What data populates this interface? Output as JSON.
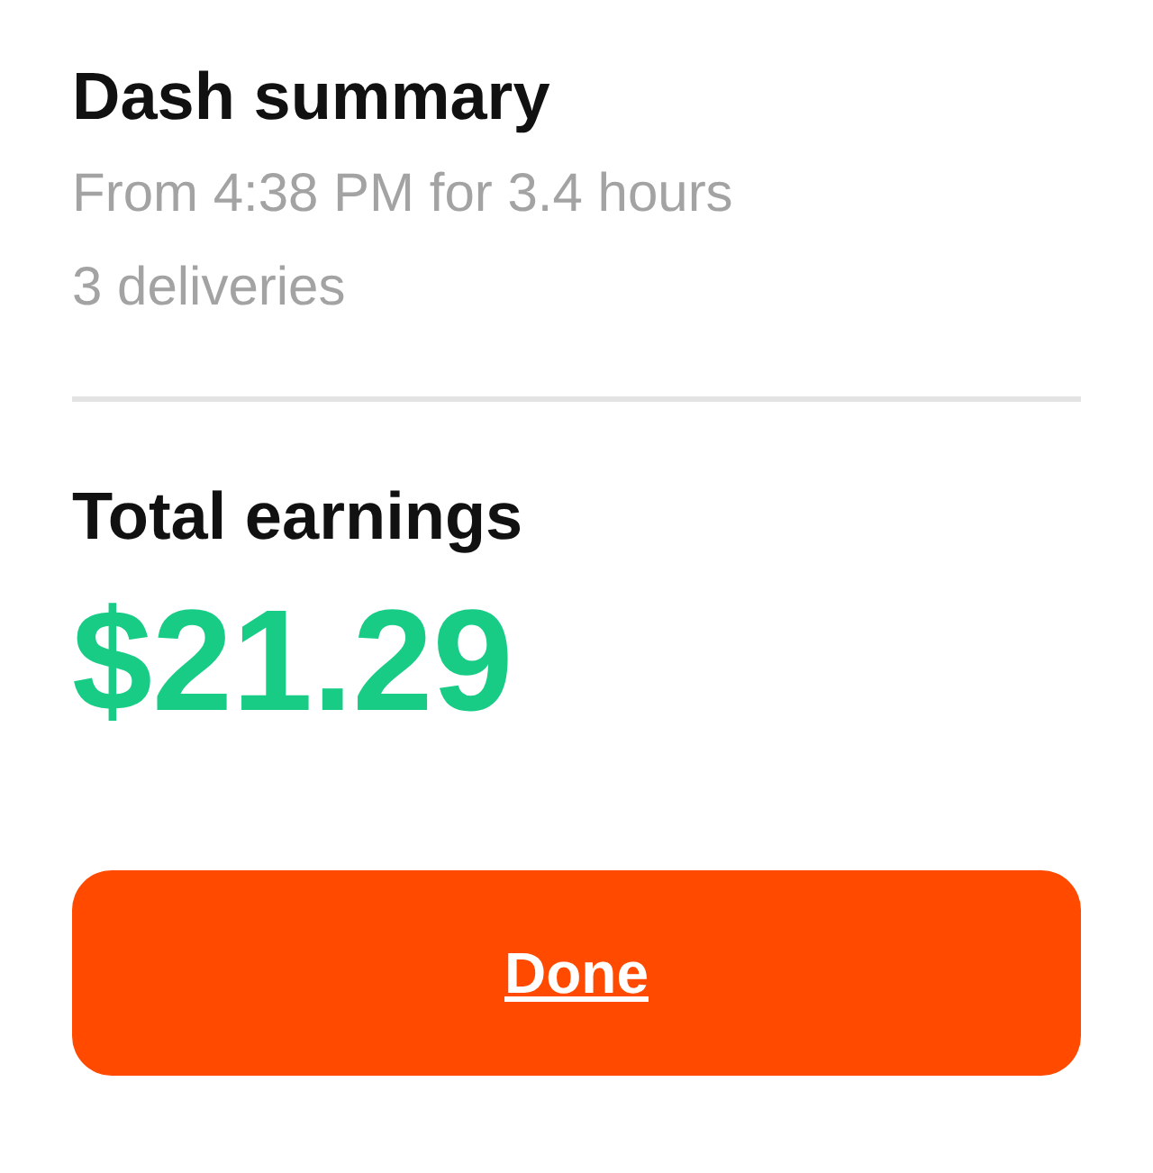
{
  "summary": {
    "title": "Dash summary",
    "time_range": "From 4:38 PM for 3.4 hours",
    "deliveries": "3 deliveries"
  },
  "earnings": {
    "label": "Total earnings",
    "amount": "$21.29"
  },
  "button": {
    "label": "Done"
  }
}
